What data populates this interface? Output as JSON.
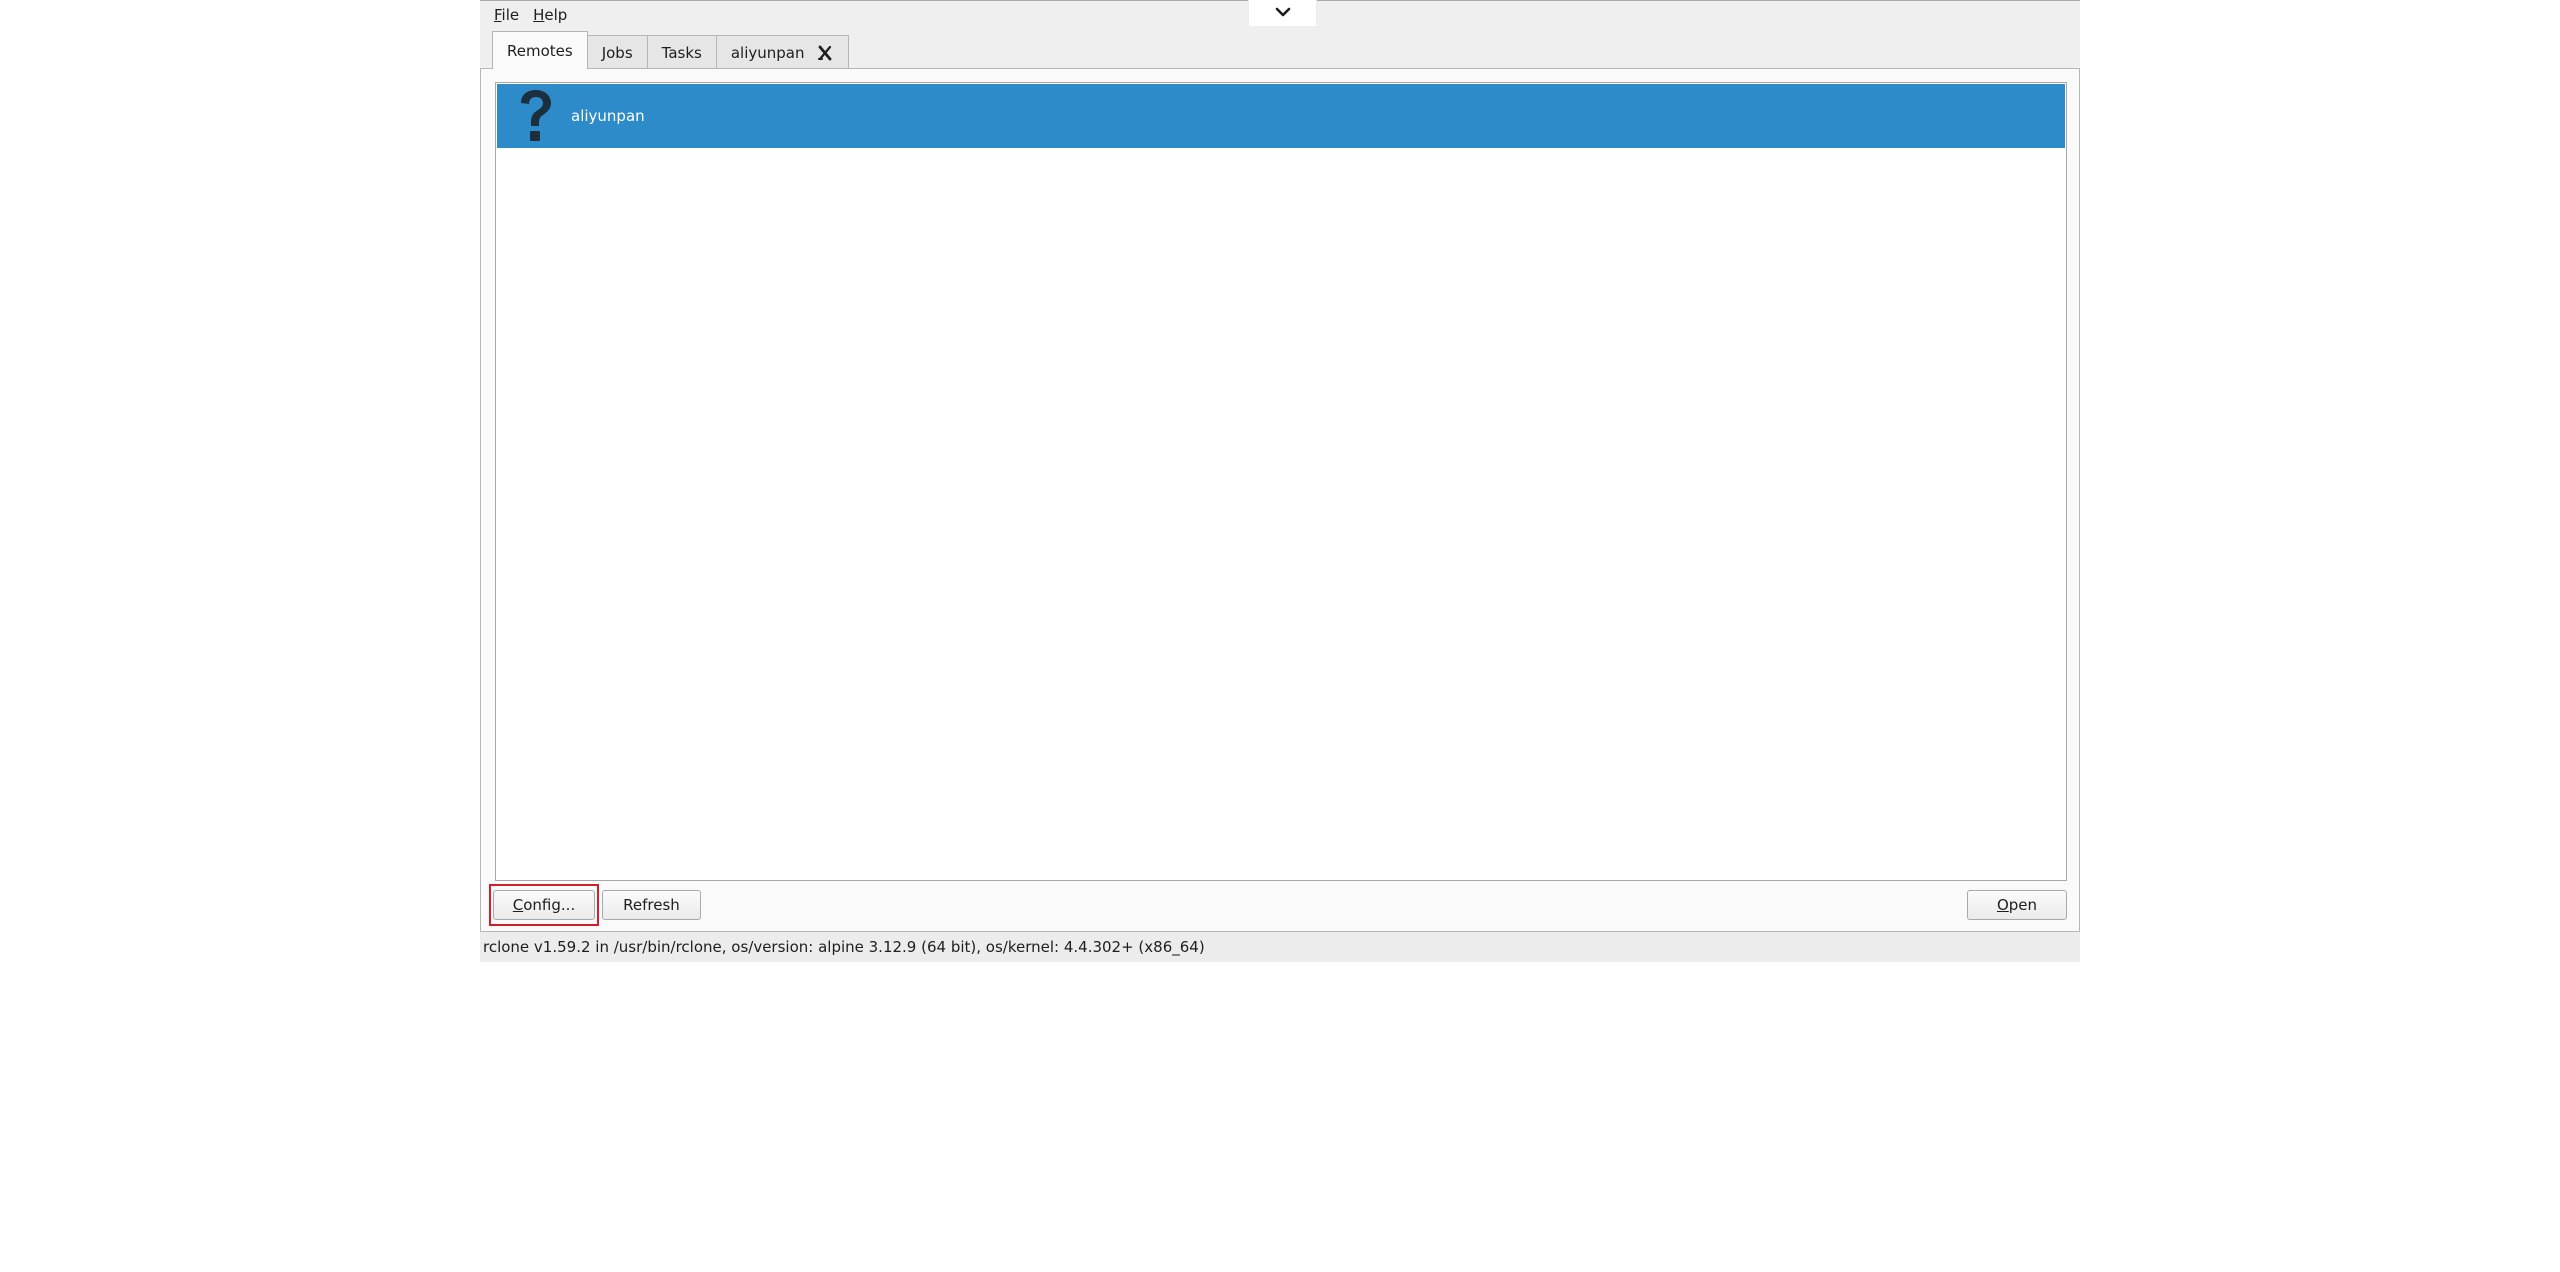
{
  "menubar": {
    "items": [
      {
        "mnemonic": "F",
        "rest": "ile"
      },
      {
        "mnemonic": "H",
        "rest": "elp"
      }
    ]
  },
  "tabs": [
    {
      "label": "Remotes",
      "active": true
    },
    {
      "label": "Jobs",
      "active": false
    },
    {
      "label": "Tasks",
      "active": false
    },
    {
      "label": "aliyunpan",
      "active": false,
      "closable": true
    }
  ],
  "remotes": [
    {
      "name": "aliyunpan",
      "icon": "question-mark-icon",
      "selected": true
    }
  ],
  "buttons": {
    "config": {
      "mnemonic": "C",
      "rest": "onfig..."
    },
    "refresh": {
      "label": "Refresh"
    },
    "open": {
      "mnemonic": "O",
      "rest": "pen"
    }
  },
  "status": {
    "text": "rclone v1.59.2 in /usr/bin/rclone, os/version: alpine 3.12.9 (64 bit), os/kernel: 4.4.302+ (x86_64)"
  },
  "colors": {
    "selection": "#2d8bc9",
    "highlight_box": "#d0202a",
    "icon_dark": "#1b2f3f"
  },
  "icons": {
    "top_handle": "chevron-down-icon",
    "tab_close": "close-icon"
  }
}
